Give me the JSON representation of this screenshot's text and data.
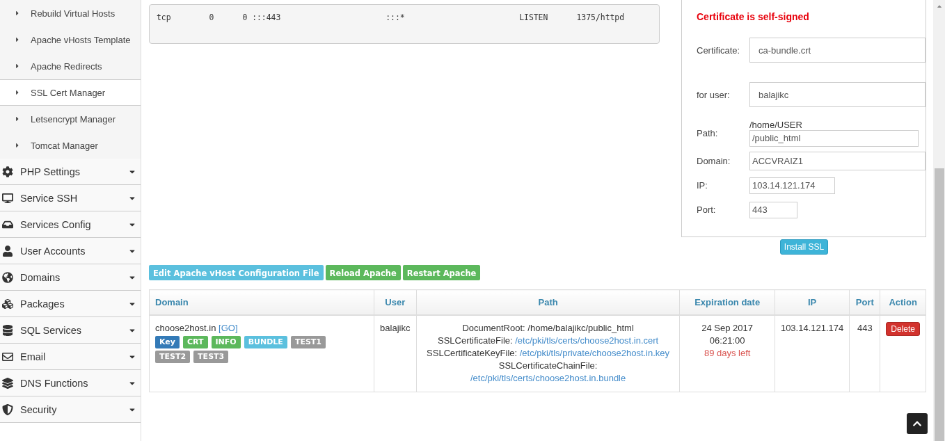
{
  "sidebar": {
    "subitems": [
      {
        "label": "Rebuild Virtual Hosts",
        "selected": false
      },
      {
        "label": "Apache vHosts Template",
        "selected": false
      },
      {
        "label": "Apache Redirects",
        "selected": false
      },
      {
        "label": "SSL Cert Manager",
        "selected": true
      },
      {
        "label": "Letsencrypt Manager",
        "selected": false
      },
      {
        "label": "Tomcat Manager",
        "selected": false
      }
    ],
    "menu": [
      "PHP Settings",
      "Service SSH",
      "Services Config",
      "User Accounts",
      "Domains",
      "Packages",
      "SQL Services",
      "Email",
      "DNS Functions",
      "Security"
    ]
  },
  "listen_output": "tcp        0      0 :::443                      :::*                        LISTEN      1375/httpd",
  "install_panel": {
    "warning": "Certificate is self-signed",
    "fields": [
      {
        "kind": "wide",
        "label": "Certificate:",
        "value": "ca-bundle.crt"
      },
      {
        "kind": "wide",
        "label": "for user:",
        "value": "balajikc"
      },
      {
        "kind": "path",
        "label": "Path:",
        "prefix": "/home/USER",
        "value": "/public_html"
      },
      {
        "kind": "plain",
        "label": "Domain:",
        "value": "ACCVRAIZ1"
      },
      {
        "kind": "medium",
        "label": "IP:",
        "value": "103.14.121.174"
      },
      {
        "kind": "short",
        "label": "Port:",
        "value": "443"
      }
    ],
    "button": "Install SSL"
  },
  "actions": [
    {
      "label": "Edit Apache vHost Configuration File",
      "color": "#5bc0de"
    },
    {
      "label": "Reload Apache",
      "color": "#5cb85c"
    },
    {
      "label": "Restart Apache",
      "color": "#5cb85c"
    }
  ],
  "table": {
    "columns": [
      "Domain",
      "User",
      "Path",
      "Expiration date",
      "IP",
      "Port",
      "Action"
    ],
    "rows": [
      {
        "domain": "choose2host.in",
        "go": "[GO]",
        "tags": [
          {
            "label": "Key",
            "color": "#337ab7"
          },
          {
            "label": "CRT",
            "color": "#5cb85c"
          },
          {
            "label": "INFO",
            "color": "#5cb85c"
          },
          {
            "label": "BUNDLE",
            "color": "#5bc0de"
          },
          {
            "label": "TEST1",
            "color": "#999999"
          },
          {
            "label": "TEST2",
            "color": "#999999"
          },
          {
            "label": "TEST3",
            "color": "#999999"
          }
        ],
        "user": "balajikc",
        "path": [
          {
            "label": "DocumentRoot:",
            "value": "/home/balajikc/public_html"
          },
          {
            "label": "SSLCertificateFile:",
            "link": "/etc/pki/tls/certs/choose2host.in.cert"
          },
          {
            "label": "SSLCertificateKeyFile:",
            "link": "/etc/pki/tls/private/choose2host.in.key"
          },
          {
            "label": "SSLCertificateChainFile:"
          },
          {
            "link": "/etc/pki/tls/certs/choose2host.in.bundle"
          }
        ],
        "date": "24 Sep 2017",
        "time": "06:21:00",
        "days_left": "89 days left",
        "ip": "103.14.121.174",
        "port": "443",
        "action": "Delete"
      }
    ]
  }
}
